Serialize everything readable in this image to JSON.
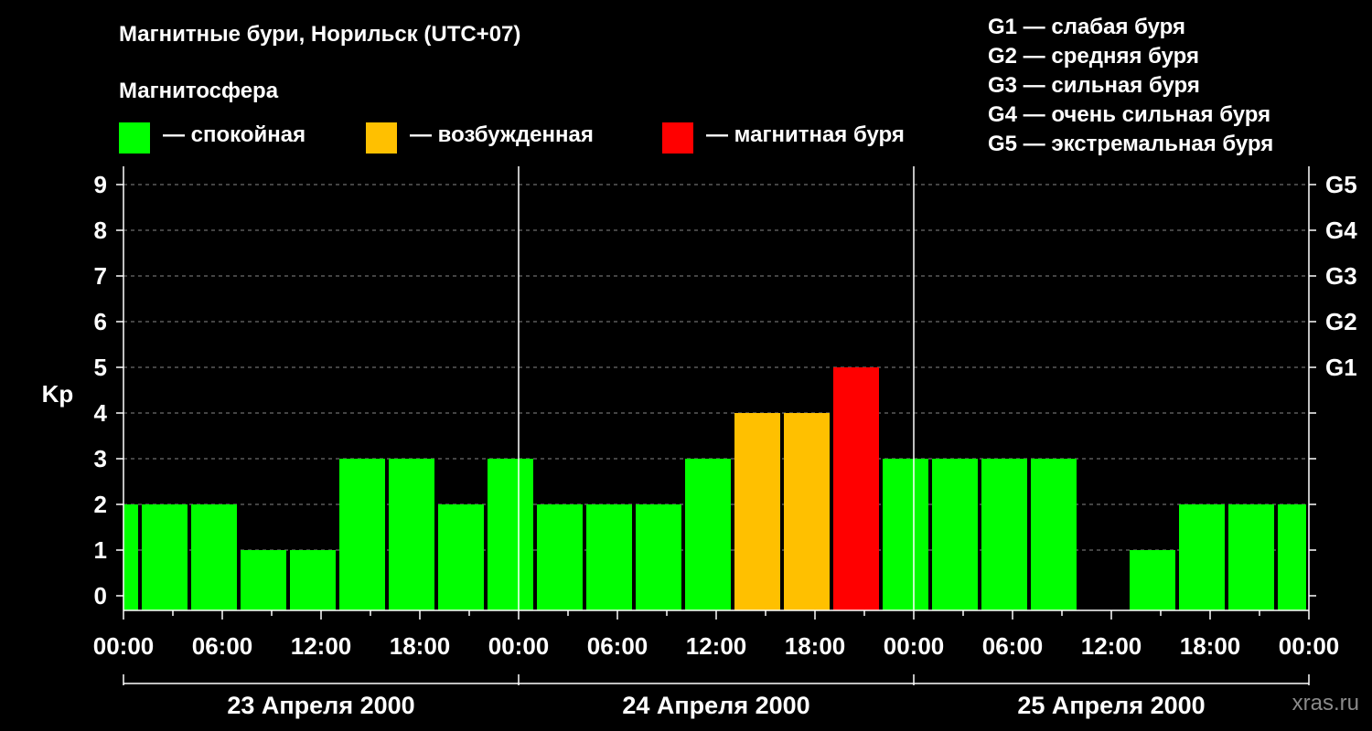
{
  "title": "Магнитные бури, Норильск (UTC+07)",
  "subtitle": "Магнитосфера",
  "legend": [
    {
      "label": "— спокойная",
      "color": "#00ff00"
    },
    {
      "label": "— возбужденная",
      "color": "#ffc000"
    },
    {
      "label": "— магнитная буря",
      "color": "#ff0000"
    }
  ],
  "g_scale": [
    "G1 — слабая буря",
    "G2 — средняя буря",
    "G3 — сильная буря",
    "G4 — очень сильная буря",
    "G5 — экстремальная буря"
  ],
  "watermark": "xras.ru",
  "chart_data": {
    "type": "bar",
    "ylabel": "Kp",
    "ylim": [
      0,
      9
    ],
    "y_ticks": [
      "0",
      "1",
      "2",
      "3",
      "4",
      "5",
      "6",
      "7",
      "8",
      "9"
    ],
    "right_ticks": [
      {
        "kp": 5,
        "label": "G1"
      },
      {
        "kp": 6,
        "label": "G2"
      },
      {
        "kp": 7,
        "label": "G3"
      },
      {
        "kp": 8,
        "label": "G4"
      },
      {
        "kp": 9,
        "label": "G5"
      }
    ],
    "x_tick_labels": [
      "00:00",
      "06:00",
      "12:00",
      "18:00",
      "00:00",
      "06:00",
      "12:00",
      "18:00",
      "00:00",
      "06:00",
      "12:00",
      "18:00",
      "00:00"
    ],
    "days": [
      "23 Апреля 2000",
      "24 Апреля 2000",
      "25 Апреля 2000"
    ],
    "interval_hours": 3,
    "series_start_hour": -2,
    "grid": "dashed horizontal",
    "values": [
      2,
      2,
      2,
      1,
      1,
      3,
      3,
      2,
      3,
      2,
      2,
      2,
      3,
      4,
      4,
      5,
      3,
      3,
      3,
      3,
      0,
      1,
      2,
      2,
      2
    ],
    "thresholds": {
      "active": 4,
      "storm": 5
    },
    "colors": {
      "quiet": "#00ff00",
      "active": "#ffc000",
      "storm": "#ff0000"
    }
  }
}
